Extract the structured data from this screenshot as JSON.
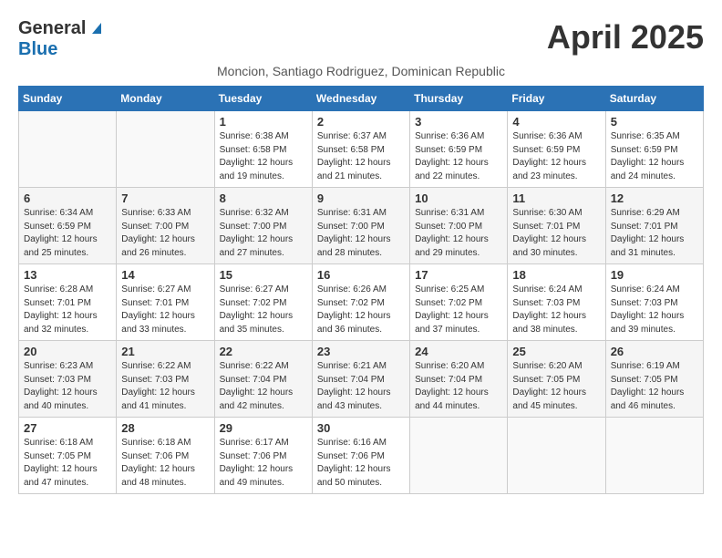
{
  "header": {
    "logo_general": "General",
    "logo_blue": "Blue",
    "month_title": "April 2025",
    "subtitle": "Moncion, Santiago Rodriguez, Dominican Republic"
  },
  "weekdays": [
    "Sunday",
    "Monday",
    "Tuesday",
    "Wednesday",
    "Thursday",
    "Friday",
    "Saturday"
  ],
  "weeks": [
    [
      {
        "day": "",
        "info": ""
      },
      {
        "day": "",
        "info": ""
      },
      {
        "day": "1",
        "info": "Sunrise: 6:38 AM\nSunset: 6:58 PM\nDaylight: 12 hours and 19 minutes."
      },
      {
        "day": "2",
        "info": "Sunrise: 6:37 AM\nSunset: 6:58 PM\nDaylight: 12 hours and 21 minutes."
      },
      {
        "day": "3",
        "info": "Sunrise: 6:36 AM\nSunset: 6:59 PM\nDaylight: 12 hours and 22 minutes."
      },
      {
        "day": "4",
        "info": "Sunrise: 6:36 AM\nSunset: 6:59 PM\nDaylight: 12 hours and 23 minutes."
      },
      {
        "day": "5",
        "info": "Sunrise: 6:35 AM\nSunset: 6:59 PM\nDaylight: 12 hours and 24 minutes."
      }
    ],
    [
      {
        "day": "6",
        "info": "Sunrise: 6:34 AM\nSunset: 6:59 PM\nDaylight: 12 hours and 25 minutes."
      },
      {
        "day": "7",
        "info": "Sunrise: 6:33 AM\nSunset: 7:00 PM\nDaylight: 12 hours and 26 minutes."
      },
      {
        "day": "8",
        "info": "Sunrise: 6:32 AM\nSunset: 7:00 PM\nDaylight: 12 hours and 27 minutes."
      },
      {
        "day": "9",
        "info": "Sunrise: 6:31 AM\nSunset: 7:00 PM\nDaylight: 12 hours and 28 minutes."
      },
      {
        "day": "10",
        "info": "Sunrise: 6:31 AM\nSunset: 7:00 PM\nDaylight: 12 hours and 29 minutes."
      },
      {
        "day": "11",
        "info": "Sunrise: 6:30 AM\nSunset: 7:01 PM\nDaylight: 12 hours and 30 minutes."
      },
      {
        "day": "12",
        "info": "Sunrise: 6:29 AM\nSunset: 7:01 PM\nDaylight: 12 hours and 31 minutes."
      }
    ],
    [
      {
        "day": "13",
        "info": "Sunrise: 6:28 AM\nSunset: 7:01 PM\nDaylight: 12 hours and 32 minutes."
      },
      {
        "day": "14",
        "info": "Sunrise: 6:27 AM\nSunset: 7:01 PM\nDaylight: 12 hours and 33 minutes."
      },
      {
        "day": "15",
        "info": "Sunrise: 6:27 AM\nSunset: 7:02 PM\nDaylight: 12 hours and 35 minutes."
      },
      {
        "day": "16",
        "info": "Sunrise: 6:26 AM\nSunset: 7:02 PM\nDaylight: 12 hours and 36 minutes."
      },
      {
        "day": "17",
        "info": "Sunrise: 6:25 AM\nSunset: 7:02 PM\nDaylight: 12 hours and 37 minutes."
      },
      {
        "day": "18",
        "info": "Sunrise: 6:24 AM\nSunset: 7:03 PM\nDaylight: 12 hours and 38 minutes."
      },
      {
        "day": "19",
        "info": "Sunrise: 6:24 AM\nSunset: 7:03 PM\nDaylight: 12 hours and 39 minutes."
      }
    ],
    [
      {
        "day": "20",
        "info": "Sunrise: 6:23 AM\nSunset: 7:03 PM\nDaylight: 12 hours and 40 minutes."
      },
      {
        "day": "21",
        "info": "Sunrise: 6:22 AM\nSunset: 7:03 PM\nDaylight: 12 hours and 41 minutes."
      },
      {
        "day": "22",
        "info": "Sunrise: 6:22 AM\nSunset: 7:04 PM\nDaylight: 12 hours and 42 minutes."
      },
      {
        "day": "23",
        "info": "Sunrise: 6:21 AM\nSunset: 7:04 PM\nDaylight: 12 hours and 43 minutes."
      },
      {
        "day": "24",
        "info": "Sunrise: 6:20 AM\nSunset: 7:04 PM\nDaylight: 12 hours and 44 minutes."
      },
      {
        "day": "25",
        "info": "Sunrise: 6:20 AM\nSunset: 7:05 PM\nDaylight: 12 hours and 45 minutes."
      },
      {
        "day": "26",
        "info": "Sunrise: 6:19 AM\nSunset: 7:05 PM\nDaylight: 12 hours and 46 minutes."
      }
    ],
    [
      {
        "day": "27",
        "info": "Sunrise: 6:18 AM\nSunset: 7:05 PM\nDaylight: 12 hours and 47 minutes."
      },
      {
        "day": "28",
        "info": "Sunrise: 6:18 AM\nSunset: 7:06 PM\nDaylight: 12 hours and 48 minutes."
      },
      {
        "day": "29",
        "info": "Sunrise: 6:17 AM\nSunset: 7:06 PM\nDaylight: 12 hours and 49 minutes."
      },
      {
        "day": "30",
        "info": "Sunrise: 6:16 AM\nSunset: 7:06 PM\nDaylight: 12 hours and 50 minutes."
      },
      {
        "day": "",
        "info": ""
      },
      {
        "day": "",
        "info": ""
      },
      {
        "day": "",
        "info": ""
      }
    ]
  ]
}
